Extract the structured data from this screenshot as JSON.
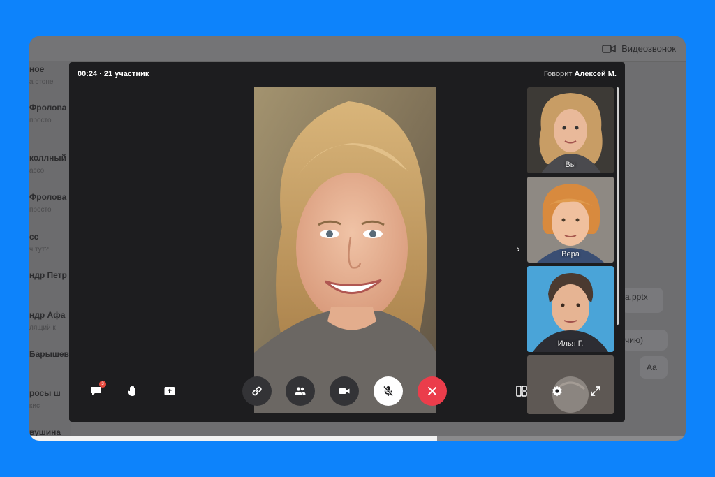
{
  "background": {
    "header": {
      "videocall_label": "Видеозвонок"
    },
    "chats": [
      {
        "name": "ное",
        "sub": "а стоне"
      },
      {
        "name": "Фролова",
        "sub": "просто"
      },
      {
        "name": "коллный",
        "sub": "ассо"
      },
      {
        "name": "Фролова",
        "sub": "просто"
      },
      {
        "name": "сс",
        "sub": "ч тут?"
      },
      {
        "name": "ндр Петр",
        "sub": ""
      },
      {
        "name": "ндр Афа",
        "sub": "лящий к"
      },
      {
        "name": "Барышев",
        "sub": ""
      },
      {
        "name": "росы ш",
        "sub": "кис"
      },
      {
        "name": "вушина",
        "sub": ""
      }
    ],
    "messages": [
      {
        "text": "а.pptx"
      },
      {
        "text": "чию)"
      },
      {
        "text": "Аа"
      }
    ]
  },
  "call": {
    "status": "00:24 · 21 участник",
    "speaking_prefix": "Говорит",
    "speaking_name": "Алексей М.",
    "main_video_name": "main-speaker",
    "participants": [
      {
        "label": "Вы"
      },
      {
        "label": "Вера"
      },
      {
        "label": "Илья Г."
      },
      {
        "label": ""
      }
    ],
    "chat_badge": "3",
    "colors": {
      "hangup": "#eb3d4b",
      "accent": "#0d83fb"
    }
  }
}
